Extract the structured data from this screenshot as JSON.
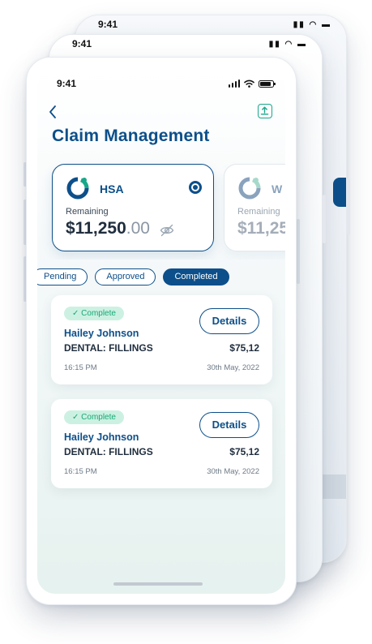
{
  "status_bar": {
    "time": "9:41"
  },
  "header": {
    "title": "Claim Management"
  },
  "accounts": [
    {
      "name": "HSA",
      "remaining_label": "Remaining",
      "amount_main": "$11,250",
      "amount_cents": ".00",
      "selected": true
    },
    {
      "name": "W",
      "remaining_label": "Remaining",
      "amount_main": "$11,25",
      "amount_cents": "",
      "selected": false
    }
  ],
  "filters": [
    {
      "label": "Pending",
      "selected": false
    },
    {
      "label": "Approved",
      "selected": false
    },
    {
      "label": "Completed",
      "selected": true
    }
  ],
  "claims": [
    {
      "status": "✓ Complete",
      "patient": "Hailey Johnson",
      "procedure": "DENTAL: FILLINGS",
      "amount": "$75,12",
      "time": "16:15 PM",
      "date": "30th May, 2022",
      "action": "Details"
    },
    {
      "status": "✓ Complete",
      "patient": "Hailey Johnson",
      "procedure": "DENTAL: FILLINGS",
      "amount": "$75,12",
      "time": "16:15 PM",
      "date": "30th May, 2022",
      "action": "Details"
    }
  ],
  "colors": {
    "brand": "#0c4f8a",
    "accent": "#19a78a",
    "badge_bg": "#ccf1e2",
    "badge_text": "#1aa876"
  },
  "icons": {
    "back": "chevron-left-icon",
    "upload": "upload-icon",
    "visibility": "eye-off-icon",
    "logo": "ring-logo-icon"
  }
}
